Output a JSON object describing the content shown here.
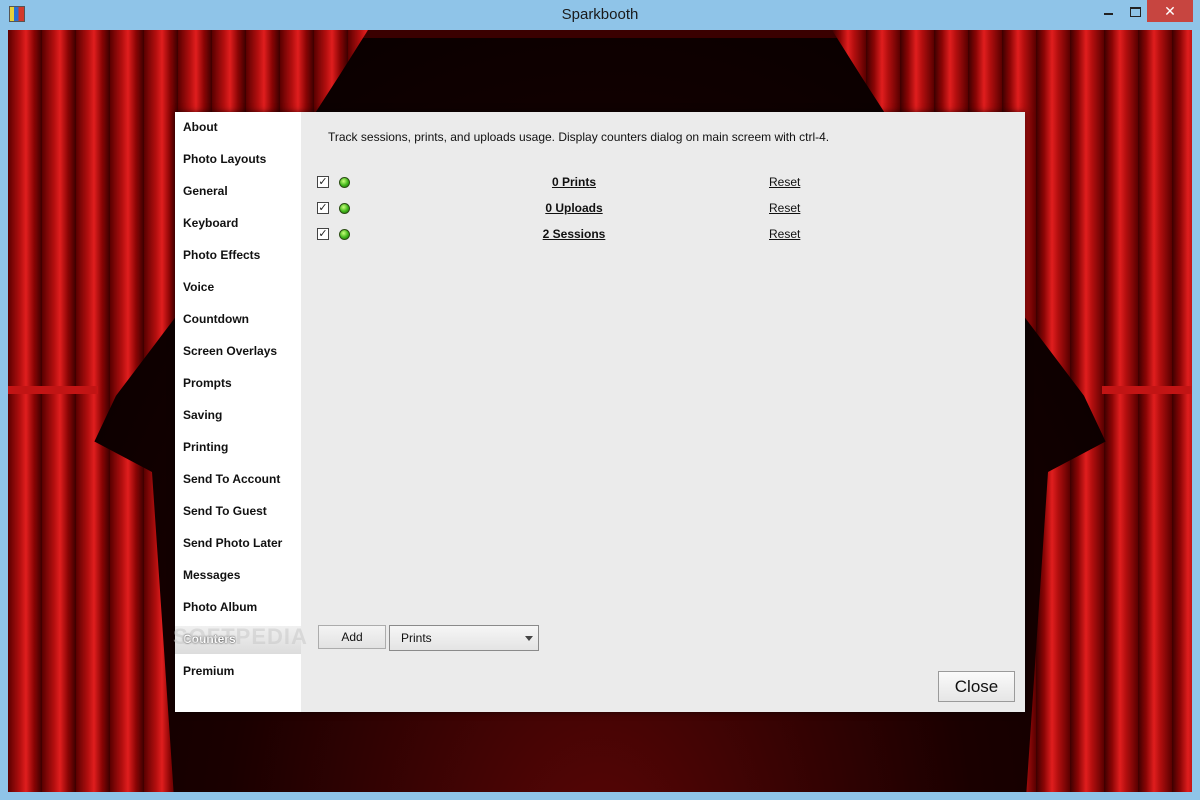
{
  "window": {
    "title": "Sparkbooth",
    "minimize_label": "",
    "close_label": "✕"
  },
  "dialog": {
    "sidebar": {
      "items": [
        {
          "label": "About"
        },
        {
          "label": "Photo Layouts"
        },
        {
          "label": "General"
        },
        {
          "label": "Keyboard"
        },
        {
          "label": "Photo Effects"
        },
        {
          "label": "Voice"
        },
        {
          "label": "Countdown"
        },
        {
          "label": "Screen Overlays"
        },
        {
          "label": "Prompts"
        },
        {
          "label": "Saving"
        },
        {
          "label": "Printing"
        },
        {
          "label": "Send To Account"
        },
        {
          "label": "Send To Guest"
        },
        {
          "label": "Send Photo Later"
        },
        {
          "label": "Messages"
        },
        {
          "label": "Photo Album"
        },
        {
          "label": "Counters"
        },
        {
          "label": "Premium"
        }
      ],
      "selected": "Counters"
    },
    "description": "Track sessions, prints, and uploads usage. Display counters dialog on main screem with ctrl-4.",
    "counters": [
      {
        "label": "0 Prints",
        "checked": true,
        "reset_label": "Reset"
      },
      {
        "label": "0 Uploads",
        "checked": true,
        "reset_label": "Reset"
      },
      {
        "label": "2 Sessions",
        "checked": true,
        "reset_label": "Reset"
      }
    ],
    "add_button_label": "Add",
    "counter_type_select": {
      "value": "Prints"
    },
    "close_button_label": "Close",
    "watermark": "SOFTPEDIA"
  },
  "colors": {
    "titlebar": "#8fc4e8",
    "close_button": "#c74540",
    "curtain": "#b30f0f"
  }
}
